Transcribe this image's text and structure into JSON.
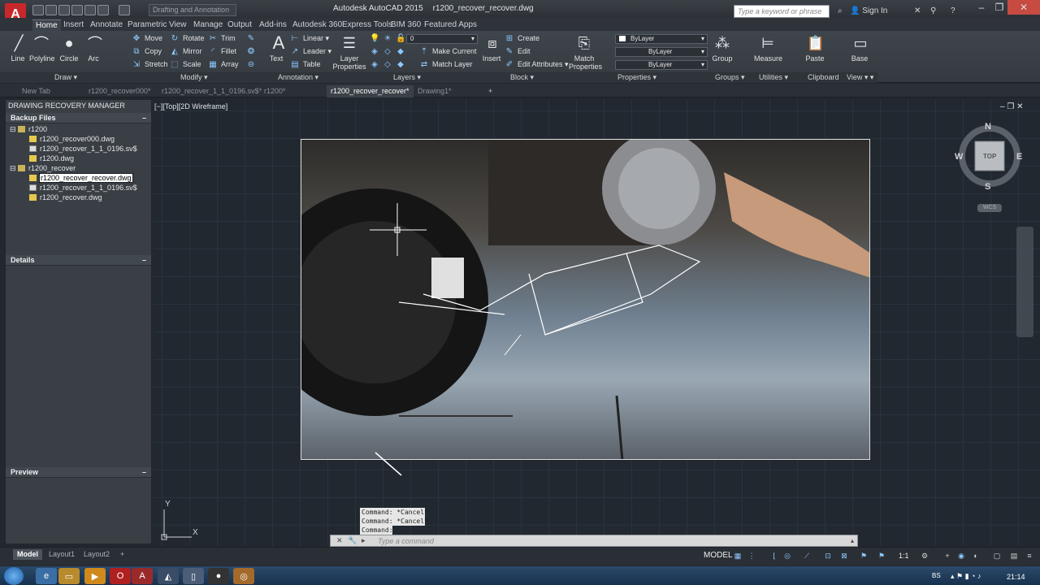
{
  "app": {
    "title": "Autodesk AutoCAD 2015",
    "document": "r1200_recover_recover.dwg",
    "workspace": "Drafting and Annotation",
    "search_placeholder": "Type a keyword or phrase",
    "sign_in": "Sign In"
  },
  "ribbon_tabs": [
    "Home",
    "Insert",
    "Annotate",
    "Parametric",
    "View",
    "Manage",
    "Output",
    "Add-ins",
    "Autodesk 360",
    "Express Tools",
    "BIM 360",
    "Featured Apps"
  ],
  "ribbon": {
    "draw": {
      "title": "Draw",
      "tools": [
        "Line",
        "Polyline",
        "Circle",
        "Arc"
      ]
    },
    "modify": {
      "title": "Modify",
      "tools": [
        "Move",
        "Rotate",
        "Trim",
        "Copy",
        "Mirror",
        "Fillet",
        "Stretch",
        "Scale",
        "Array"
      ]
    },
    "annotation": {
      "title": "Annotation",
      "text": "Text",
      "tools": [
        "Linear",
        "Leader",
        "Table"
      ]
    },
    "layers": {
      "title": "Layers",
      "properties": "Layer Properties",
      "current_layer": "0",
      "tools": [
        "Make Current",
        "Match Layer"
      ]
    },
    "block": {
      "title": "Block",
      "insert": "Insert",
      "tools": [
        "Create",
        "Edit",
        "Edit Attributes"
      ]
    },
    "properties": {
      "title": "Properties",
      "match": "Match Properties",
      "color": "ByLayer",
      "linetype": "ByLayer",
      "lineweight": "ByLayer"
    },
    "groups": {
      "title": "Groups",
      "group": "Group"
    },
    "utilities": {
      "title": "Utilities",
      "measure": "Measure"
    },
    "clipboard": {
      "title": "Clipboard",
      "paste": "Paste"
    },
    "view": {
      "title": "View",
      "base": "Base"
    }
  },
  "file_tabs": [
    "New Tab",
    "r1200_recover000*",
    "r1200_recover_1_1_0196.sv$*",
    "r1200*",
    "r1200_recover_recover*",
    "Drawing1*"
  ],
  "drm": {
    "title": "DRAWING RECOVERY MANAGER",
    "backup_header": "Backup Files",
    "groups": [
      {
        "name": "r1200",
        "files": [
          "r1200_recover000.dwg",
          "r1200_recover_1_1_0196.sv$",
          "r1200.dwg"
        ]
      },
      {
        "name": "r1200_recover",
        "files": [
          "r1200_recover_recover.dwg",
          "r1200_recover_1_1_0196.sv$",
          "r1200_recover.dwg"
        ]
      }
    ],
    "details_header": "Details",
    "preview_header": "Preview"
  },
  "viewport": {
    "label": "[−][Top][2D Wireframe]"
  },
  "viewcube": {
    "n": "N",
    "s": "S",
    "e": "E",
    "w": "W",
    "face": "TOP",
    "wcs": "WCS"
  },
  "ucs": {
    "x": "X",
    "y": "Y"
  },
  "command": {
    "history": [
      "Command: *Cancel*",
      "Command: *Cancel*",
      "Command:"
    ],
    "placeholder": "Type a command"
  },
  "layout_tabs": [
    "Model",
    "Layout1",
    "Layout2"
  ],
  "status": {
    "space": "MODEL",
    "scale": "1:1"
  },
  "taskbar": {
    "lang": "BS",
    "time": "21:14"
  },
  "colors": {
    "accent": "#c8282a",
    "ribbon": "#3a4047",
    "canvas": "#212830"
  }
}
